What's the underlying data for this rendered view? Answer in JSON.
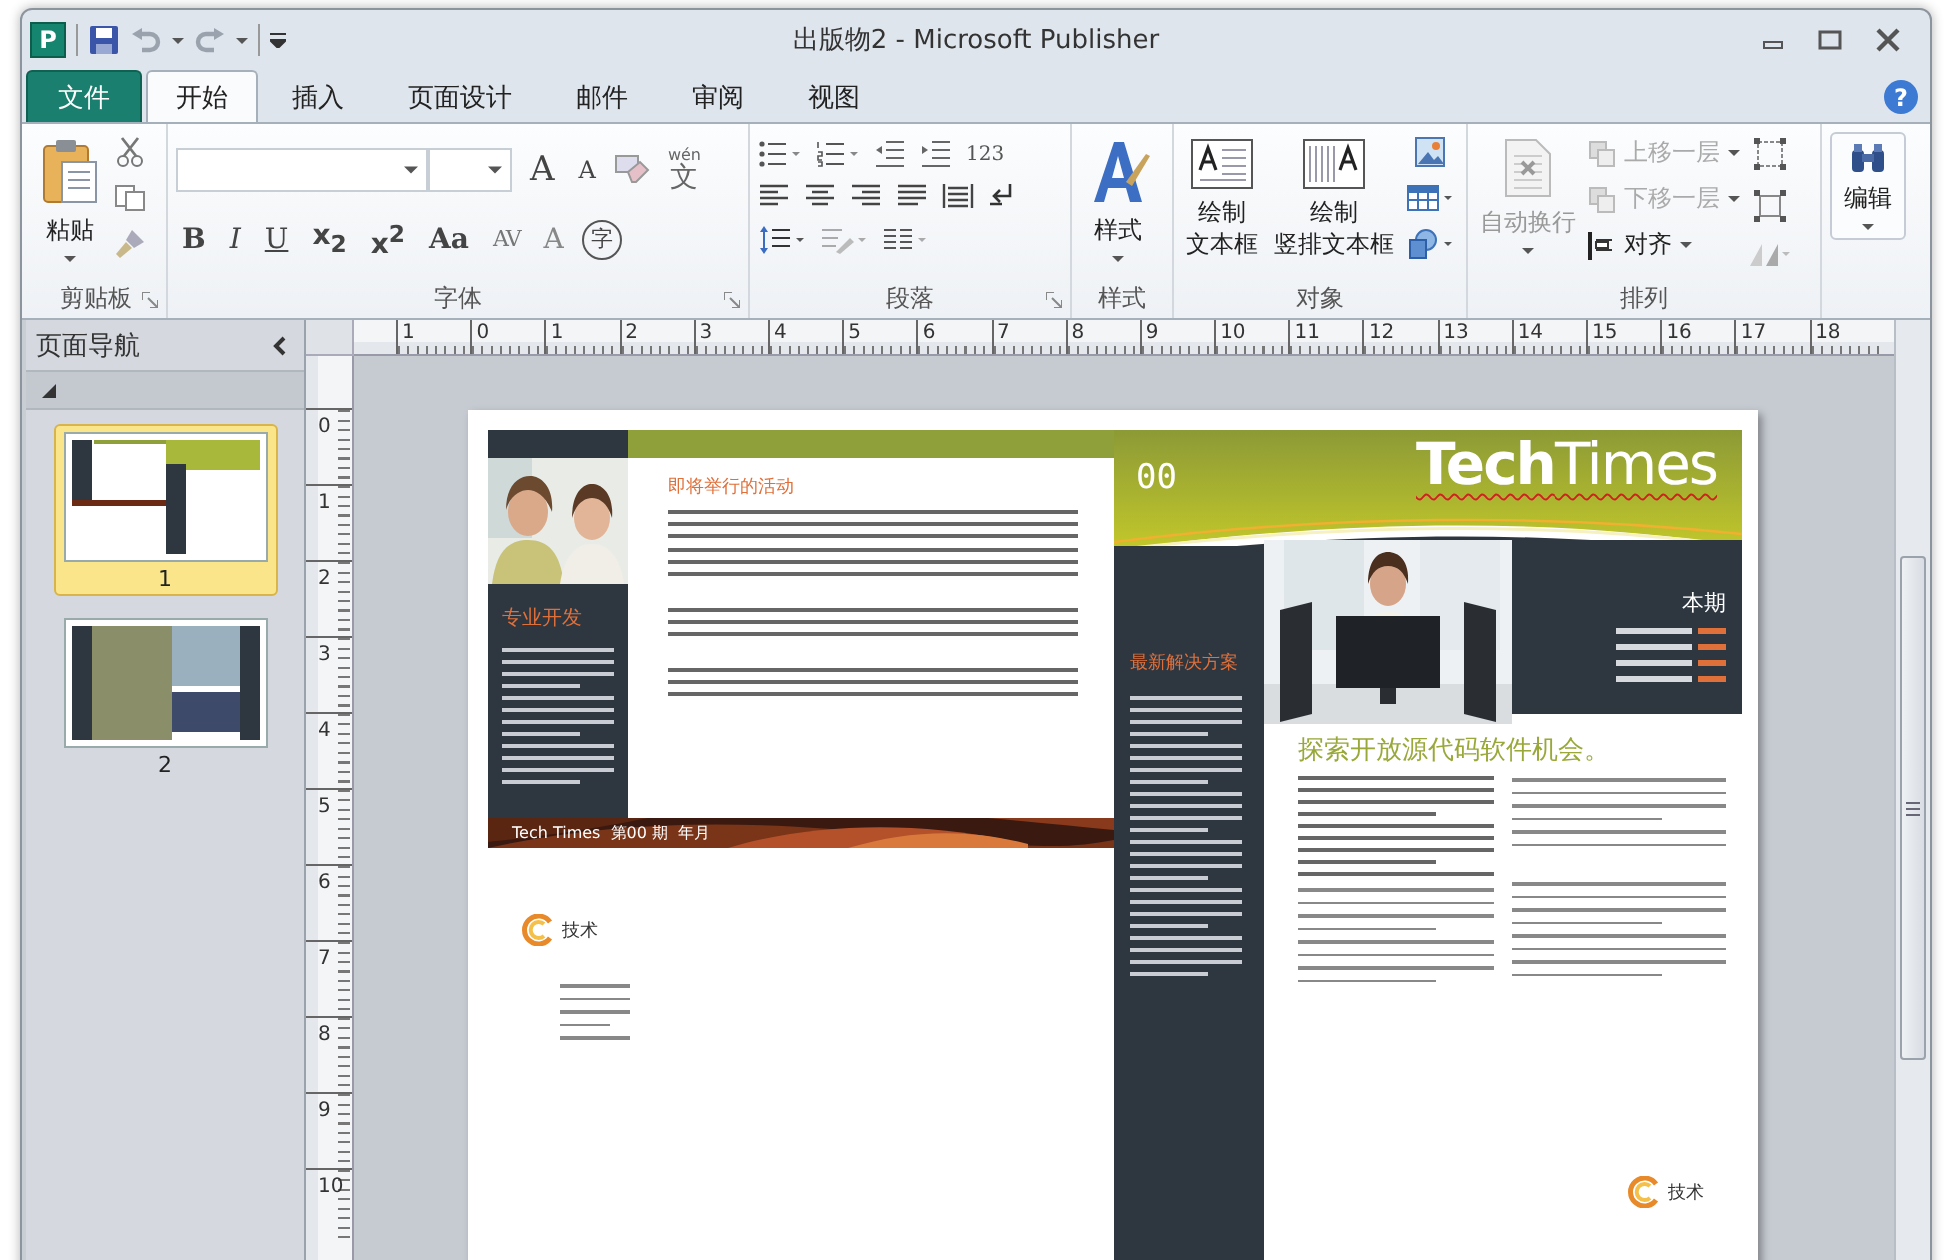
{
  "window": {
    "app_icon": "P",
    "title": "出版物2 - Microsoft Publisher",
    "help": "?"
  },
  "tabs": [
    {
      "label": "文件",
      "kind": "file",
      "selected": false
    },
    {
      "label": "开始",
      "kind": "tab",
      "selected": true
    },
    {
      "label": "插入",
      "kind": "tab",
      "selected": false
    },
    {
      "label": "页面设计",
      "kind": "tab",
      "selected": false
    },
    {
      "label": "邮件",
      "kind": "tab",
      "selected": false
    },
    {
      "label": "审阅",
      "kind": "tab",
      "selected": false
    },
    {
      "label": "视图",
      "kind": "tab",
      "selected": false
    }
  ],
  "ribbon": {
    "groups": [
      {
        "kind": "clipboard",
        "label": "剪贴板",
        "buttons": [
          {
            "label": "粘贴",
            "disabled": false
          }
        ]
      },
      {
        "kind": "font",
        "label": "字体",
        "top": [
          {
            "kind": "grow",
            "label": "A"
          },
          {
            "kind": "shrink",
            "label": "A"
          },
          {
            "kind": "clear"
          },
          {
            "kind": "phonetic",
            "label": "文",
            "ruby": "wén"
          }
        ],
        "bottom": [
          {
            "kind": "bold",
            "label": "B"
          },
          {
            "kind": "italic",
            "label": "I"
          },
          {
            "kind": "underline",
            "label": "U"
          },
          {
            "kind": "script",
            "label": "x$_{2}$"
          },
          {
            "kind": "script",
            "label": "x$^{2}$"
          },
          {
            "kind": "case",
            "label": "Aa"
          },
          {
            "kind": "spacing",
            "label": "AV"
          },
          {
            "kind": "color",
            "label": "A"
          },
          {
            "kind": "enclose",
            "label": "字"
          }
        ]
      },
      {
        "kind": "paragraph",
        "label": "段落",
        "numbers": "123"
      },
      {
        "kind": "styles",
        "label": "样式",
        "buttons": [
          {
            "label": "样式",
            "disabled": false
          }
        ]
      },
      {
        "kind": "objects",
        "label": "对象",
        "buttons": [
          {
            "lines": [
              "绘制",
              "文本框"
            ],
            "disabled": false
          },
          {
            "lines": [
              "绘制",
              "竖排文本框"
            ],
            "disabled": false
          }
        ]
      },
      {
        "kind": "arrange",
        "label": "排列",
        "buttons": [
          {
            "label": "自动换行",
            "disabled": true
          },
          {
            "label": "上移一层",
            "disabled": true
          },
          {
            "label": "下移一层",
            "disabled": true
          },
          {
            "label": "对齐",
            "disabled": false
          }
        ]
      },
      {
        "kind": "editing",
        "buttons": [
          {
            "label": "编辑",
            "disabled": false
          }
        ]
      }
    ]
  },
  "navigation": {
    "title": "页面导航",
    "pages": [
      {
        "label": "1",
        "selected": true
      },
      {
        "label": "2",
        "selected": false
      }
    ]
  },
  "rulers": {
    "horizontal": [
      "1",
      "0",
      "1",
      "2",
      "3",
      "4",
      "5",
      "6",
      "7",
      "8",
      "9",
      "10",
      "11",
      "12",
      "13",
      "14",
      "15",
      "16",
      "17",
      "18"
    ],
    "vertical": [
      "0",
      "1",
      "2",
      "3",
      "4",
      "5",
      "6",
      "7",
      "8",
      "9",
      "10"
    ]
  },
  "publication": {
    "events_heading": "即将举行的活动",
    "sidebar_heading": "专业开发",
    "footer": "Tech Times  第00 期  年月",
    "logo_text": "技术",
    "issue_number": "00",
    "masthead": "**Tech**Times",
    "solutions_heading": "最新解决方案",
    "contents_heading": "本期",
    "headline": "探索开放源代码软件机会。",
    "back_logo_text": "技术"
  }
}
